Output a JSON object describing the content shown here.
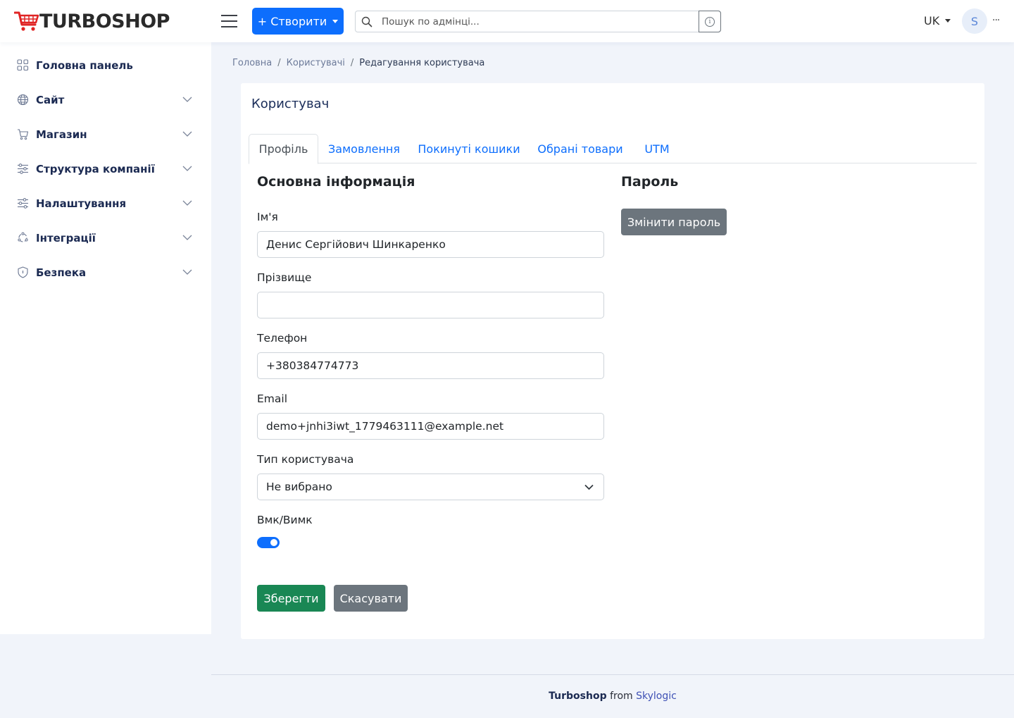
{
  "header": {
    "logo_text": "TURBOSHOP",
    "create_label": "+ Створити",
    "search_placeholder": "Пошук по адмінці...",
    "language": "UK",
    "avatar_initial": "S",
    "more": "···"
  },
  "sidebar": {
    "items": [
      {
        "label": "Головна панель",
        "icon": "dashboard-icon",
        "expandable": false
      },
      {
        "label": "Сайт",
        "icon": "globe-icon",
        "expandable": true
      },
      {
        "label": "Магазин",
        "icon": "cart-icon",
        "expandable": true
      },
      {
        "label": "Структура компанії",
        "icon": "sliders-icon",
        "expandable": true
      },
      {
        "label": "Налаштування",
        "icon": "settings-sliders-icon",
        "expandable": true
      },
      {
        "label": "Інтеграції",
        "icon": "integrations-icon",
        "expandable": true
      },
      {
        "label": "Безпека",
        "icon": "shield-icon",
        "expandable": true
      }
    ]
  },
  "breadcrumb": {
    "home": "Головна",
    "users": "Користувачі",
    "current": "Редагування користувача"
  },
  "card": {
    "title": "Користувач",
    "tabs": [
      "Профіль",
      "Замовлення",
      "Покинуті кошики",
      "Обрані товари",
      "UTM"
    ],
    "active_tab": "Профіль"
  },
  "form": {
    "section_title": "Основна інформація",
    "first_name_label": "Ім'я",
    "first_name_value": "Денис Сергійович Шинкаренко",
    "last_name_label": "Прізвище",
    "last_name_value": "",
    "phone_label": "Телефон",
    "phone_value": "+380384774773",
    "email_label": "Email",
    "email_value": "demo+jnhi3iwt_1779463111@example.net",
    "user_type_label": "Тип користувача",
    "user_type_value": "Не вибрано",
    "toggle_label": "Вмк/Вимк",
    "toggle_on": true,
    "save_label": "Зберегти",
    "cancel_label": "Скасувати"
  },
  "password": {
    "section_title": "Пароль",
    "change_label": "Змінити пароль"
  },
  "footer": {
    "brand": "Turboshop",
    "from": "from",
    "company": "Skylogic"
  },
  "colors": {
    "primary": "#0d6efd",
    "success": "#198754",
    "secondary": "#6c757d",
    "logo_red": "#e02424",
    "nav_text": "#1b2a52"
  }
}
